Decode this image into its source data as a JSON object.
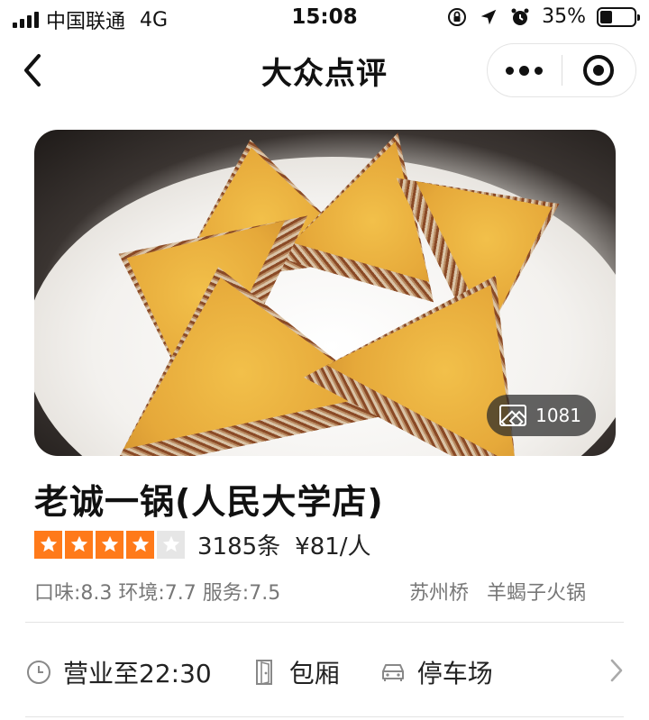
{
  "status_bar": {
    "carrier": "中国联通",
    "network": "4G",
    "time": "15:08",
    "battery": "35%",
    "battery_level": 0.35
  },
  "nav": {
    "title": "大众点评"
  },
  "photo": {
    "count": "1081"
  },
  "shop": {
    "name": "老诚一锅(人民大学店)",
    "rating_stars": 4,
    "rating_max": 5,
    "reviews": "3185条",
    "price": "¥81/人",
    "scores": "口味:8.3 环境:7.7 服务:7.5",
    "area": "苏州桥",
    "category": "羊蝎子火锅"
  },
  "features": [
    {
      "label": "营业至22:30",
      "icon": "clock-icon"
    },
    {
      "label": "包厢",
      "icon": "door-icon"
    },
    {
      "label": "停车场",
      "icon": "car-icon"
    }
  ],
  "colors": {
    "star": "#ff7a1a",
    "star_off": "#e6e6e6",
    "text_secondary": "#777777"
  }
}
